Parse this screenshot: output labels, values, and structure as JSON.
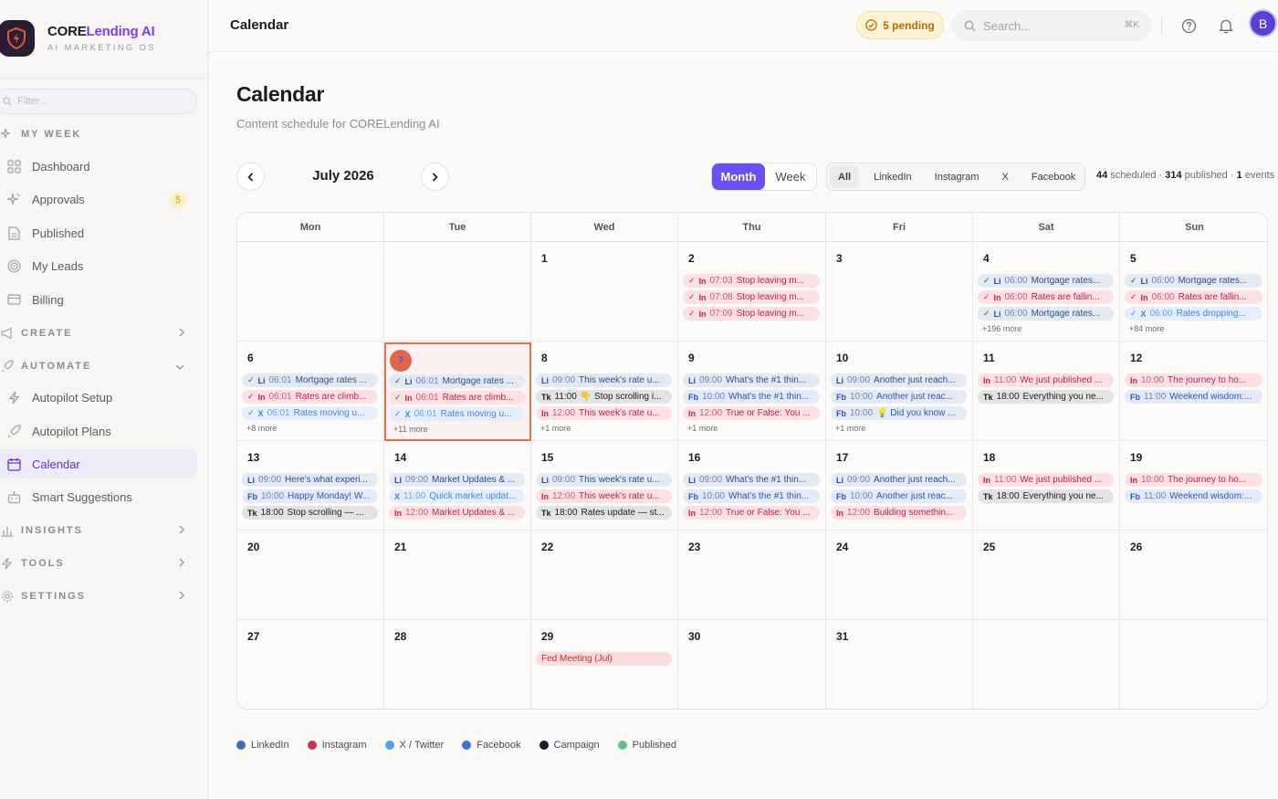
{
  "brand": {
    "name_part1": "CORE",
    "name_part2": "Lending AI",
    "subtitle": "AI MARKETING OS"
  },
  "sidebar": {
    "filter_placeholder": "Filter...",
    "my_week_label": "MY WEEK",
    "items_main": [
      {
        "label": "Dashboard",
        "icon": "grid-icon"
      },
      {
        "label": "Approvals",
        "icon": "sparkle-check-icon",
        "badge": "5"
      },
      {
        "label": "Published",
        "icon": "document-icon"
      },
      {
        "label": "My Leads",
        "icon": "target-icon"
      },
      {
        "label": "Billing",
        "icon": "card-icon"
      }
    ],
    "create_label": "CREATE",
    "automate_label": "AUTOMATE",
    "items_automate": [
      {
        "label": "Autopilot Setup",
        "icon": "bolt-icon"
      },
      {
        "label": "Autopilot Plans",
        "icon": "rocket-icon"
      },
      {
        "label": "Calendar",
        "icon": "calendar-icon",
        "active": true
      },
      {
        "label": "Smart Suggestions",
        "icon": "robot-icon"
      }
    ],
    "insights_label": "INSIGHTS",
    "tools_label": "TOOLS",
    "settings_label": "SETTINGS"
  },
  "topbar": {
    "title": "Calendar",
    "pending_label": "5 pending",
    "search_placeholder": "Search...",
    "search_shortcut": "⌘K",
    "avatar_initial": "B"
  },
  "main": {
    "title": "Calendar",
    "subtitle": "Content schedule for CORELending AI",
    "month_label": "July 2026",
    "view_month": "Month",
    "view_week": "Week",
    "filters": [
      "All",
      "LinkedIn",
      "Instagram",
      "X",
      "Facebook"
    ],
    "stats": {
      "scheduled_count": "44",
      "scheduled_label": " scheduled · ",
      "published_count": "314",
      "published_label": " published · ",
      "events_count": "1",
      "events_label": " events"
    }
  },
  "calendar": {
    "weekdays": [
      "Mon",
      "Tue",
      "Wed",
      "Thu",
      "Fri",
      "Sat",
      "Sun"
    ],
    "today": 7,
    "weeks": [
      [
        {
          "day": "",
          "events": []
        },
        {
          "day": "",
          "events": []
        },
        {
          "day": "1",
          "events": []
        },
        {
          "day": "2",
          "events": [
            {
              "p": "instagram",
              "tag": "In",
              "time": "07:03",
              "title": "Stop leaving m...",
              "check": true
            },
            {
              "p": "instagram",
              "tag": "In",
              "time": "07:08",
              "title": "Stop leaving m...",
              "check": true
            },
            {
              "p": "instagram",
              "tag": "In",
              "time": "07:09",
              "title": "Stop leaving m...",
              "check": true
            }
          ]
        },
        {
          "day": "3",
          "events": []
        },
        {
          "day": "4",
          "events": [
            {
              "p": "linkedin",
              "tag": "Li",
              "time": "06:00",
              "title": "Mortgage rates...",
              "check": true
            },
            {
              "p": "instagram",
              "tag": "In",
              "time": "06:00",
              "title": "Rates are fallin...",
              "check": true
            },
            {
              "p": "linkedin",
              "tag": "Li",
              "time": "06:00",
              "title": "Mortgage rates...",
              "check": true
            }
          ],
          "more": "+196 more"
        },
        {
          "day": "5",
          "events": [
            {
              "p": "linkedin",
              "tag": "Li",
              "time": "06:00",
              "title": "Mortgage rates...",
              "check": true
            },
            {
              "p": "instagram",
              "tag": "In",
              "time": "06:00",
              "title": "Rates are fallin...",
              "check": true
            },
            {
              "p": "x",
              "tag": "X",
              "time": "06:00",
              "title": "Rates dropping...",
              "check": true
            }
          ],
          "more": "+84 more"
        }
      ],
      [
        {
          "day": "6",
          "events": [
            {
              "p": "linkedin",
              "tag": "Li",
              "time": "06:01",
              "title": "Mortgage rates ...",
              "check": true
            },
            {
              "p": "instagram",
              "tag": "In",
              "time": "06:01",
              "title": "Rates are climb...",
              "check": true
            },
            {
              "p": "x",
              "tag": "X",
              "time": "06:01",
              "title": "Rates moving u...",
              "check": true
            }
          ],
          "more": "+8 more"
        },
        {
          "day": "7",
          "events": [
            {
              "p": "linkedin",
              "tag": "Li",
              "time": "06:01",
              "title": "Mortgage rates ...",
              "check": true
            },
            {
              "p": "instagram",
              "tag": "In",
              "time": "06:01",
              "title": "Rates are climb...",
              "check": true
            },
            {
              "p": "x",
              "tag": "X",
              "time": "06:01",
              "title": "Rates moving u...",
              "check": true
            }
          ],
          "more": "+11 more"
        },
        {
          "day": "8",
          "events": [
            {
              "p": "linkedin",
              "tag": "Li",
              "time": "09:00",
              "title": "This week's rate u..."
            },
            {
              "p": "tiktok",
              "tag": "Tk",
              "time": "11:00",
              "title": "👇 Stop scrolling i..."
            },
            {
              "p": "instagram",
              "tag": "In",
              "time": "12:00",
              "title": "This week's rate u..."
            }
          ],
          "more": "+1 more"
        },
        {
          "day": "9",
          "events": [
            {
              "p": "linkedin",
              "tag": "Li",
              "time": "09:00",
              "title": "What's the #1 thin..."
            },
            {
              "p": "facebook",
              "tag": "Fb",
              "time": "10:00",
              "title": "What's the #1 thin..."
            },
            {
              "p": "instagram",
              "tag": "In",
              "time": "12:00",
              "title": "True or False: You ..."
            }
          ],
          "more": "+1 more"
        },
        {
          "day": "10",
          "events": [
            {
              "p": "linkedin",
              "tag": "Li",
              "time": "09:00",
              "title": "Another just reach..."
            },
            {
              "p": "facebook",
              "tag": "Fb",
              "time": "10:00",
              "title": "Another just reac..."
            },
            {
              "p": "facebook",
              "tag": "Fb",
              "time": "10:00",
              "title": "💡 Did you know ..."
            }
          ],
          "more": "+1 more"
        },
        {
          "day": "11",
          "events": [
            {
              "p": "instagram",
              "tag": "In",
              "time": "11:00",
              "title": "We just published ..."
            },
            {
              "p": "tiktok",
              "tag": "Tk",
              "time": "18:00",
              "title": "Everything you ne..."
            }
          ]
        },
        {
          "day": "12",
          "events": [
            {
              "p": "instagram",
              "tag": "In",
              "time": "10:00",
              "title": "The journey to ho..."
            },
            {
              "p": "facebook",
              "tag": "Fb",
              "time": "11:00",
              "title": "Weekend wisdom:..."
            }
          ]
        }
      ],
      [
        {
          "day": "13",
          "events": [
            {
              "p": "linkedin",
              "tag": "Li",
              "time": "09:00",
              "title": "Here's what experi..."
            },
            {
              "p": "facebook",
              "tag": "Fb",
              "time": "10:00",
              "title": "Happy Monday! W..."
            },
            {
              "p": "tiktok",
              "tag": "Tk",
              "time": "18:00",
              "title": "Stop scrolling — ..."
            }
          ]
        },
        {
          "day": "14",
          "events": [
            {
              "p": "linkedin",
              "tag": "Li",
              "time": "09:00",
              "title": "Market Updates & ..."
            },
            {
              "p": "x",
              "tag": "X",
              "time": "11:00",
              "title": "Quick market updat..."
            },
            {
              "p": "instagram",
              "tag": "In",
              "time": "12:00",
              "title": "Market Updates & ..."
            }
          ]
        },
        {
          "day": "15",
          "events": [
            {
              "p": "linkedin",
              "tag": "Li",
              "time": "09:00",
              "title": "This week's rate u..."
            },
            {
              "p": "instagram",
              "tag": "In",
              "time": "12:00",
              "title": "This week's rate u..."
            },
            {
              "p": "tiktok",
              "tag": "Tk",
              "time": "18:00",
              "title": "Rates update — st..."
            }
          ]
        },
        {
          "day": "16",
          "events": [
            {
              "p": "linkedin",
              "tag": "Li",
              "time": "09:00",
              "title": "What's the #1 thin..."
            },
            {
              "p": "facebook",
              "tag": "Fb",
              "time": "10:00",
              "title": "What's the #1 thin..."
            },
            {
              "p": "instagram",
              "tag": "In",
              "time": "12:00",
              "title": "True or False: You ..."
            }
          ]
        },
        {
          "day": "17",
          "events": [
            {
              "p": "linkedin",
              "tag": "Li",
              "time": "09:00",
              "title": "Another just reach..."
            },
            {
              "p": "facebook",
              "tag": "Fb",
              "time": "10:00",
              "title": "Another just reac..."
            },
            {
              "p": "instagram",
              "tag": "In",
              "time": "12:00",
              "title": "Building somethin..."
            }
          ]
        },
        {
          "day": "18",
          "events": [
            {
              "p": "instagram",
              "tag": "In",
              "time": "11:00",
              "title": "We just published ..."
            },
            {
              "p": "tiktok",
              "tag": "Tk",
              "time": "18:00",
              "title": "Everything you ne..."
            }
          ]
        },
        {
          "day": "19",
          "events": [
            {
              "p": "instagram",
              "tag": "In",
              "time": "10:00",
              "title": "The journey to ho..."
            },
            {
              "p": "facebook",
              "tag": "Fb",
              "time": "11:00",
              "title": "Weekend wisdom:..."
            }
          ]
        }
      ],
      [
        {
          "day": "20",
          "events": []
        },
        {
          "day": "21",
          "events": []
        },
        {
          "day": "22",
          "events": []
        },
        {
          "day": "23",
          "events": []
        },
        {
          "day": "24",
          "events": []
        },
        {
          "day": "25",
          "events": []
        },
        {
          "day": "26",
          "events": []
        }
      ],
      [
        {
          "day": "27",
          "events": []
        },
        {
          "day": "28",
          "events": []
        },
        {
          "day": "29",
          "events": [
            {
              "p": "campaign",
              "tag": "",
              "time": "",
              "title": "Fed Meeting (Jul)"
            }
          ]
        },
        {
          "day": "30",
          "events": []
        },
        {
          "day": "31",
          "events": []
        },
        {
          "day": "",
          "events": []
        },
        {
          "day": "",
          "events": []
        }
      ]
    ]
  },
  "legend": [
    {
      "label": "LinkedIn",
      "color": "#3d6fb4"
    },
    {
      "label": "Instagram",
      "color": "#c8335e"
    },
    {
      "label": "X / Twitter",
      "color": "#5aa0e8"
    },
    {
      "label": "Facebook",
      "color": "#3f6fe0"
    },
    {
      "label": "Campaign",
      "color": "#1c1b2e"
    },
    {
      "label": "Published",
      "color": "#5cbf83"
    }
  ]
}
